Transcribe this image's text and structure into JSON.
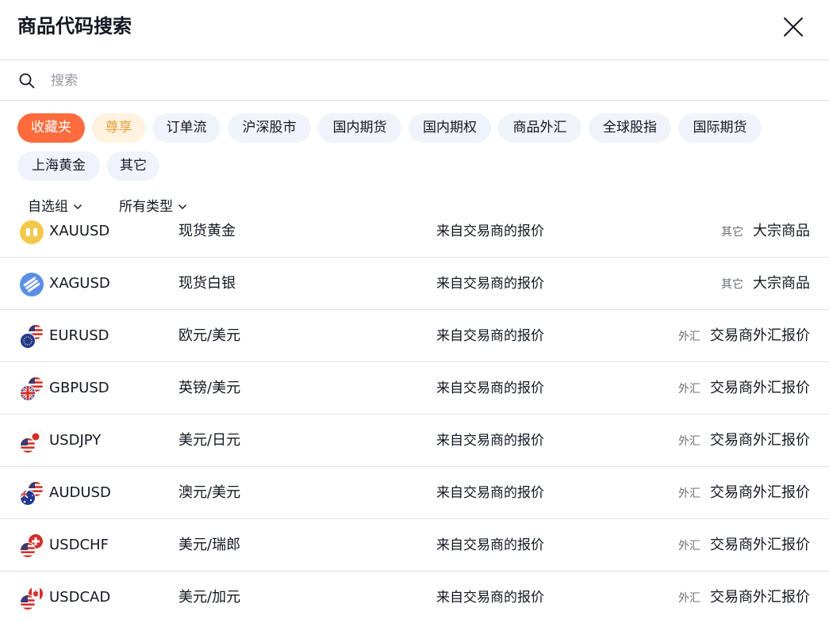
{
  "dialog": {
    "title": "商品代码搜索"
  },
  "search": {
    "placeholder": "搜索"
  },
  "chips": [
    {
      "label": "收藏夹",
      "state": "active"
    },
    {
      "label": "尊享",
      "state": "premium"
    },
    {
      "label": "订单流",
      "state": "normal"
    },
    {
      "label": "沪深股市",
      "state": "normal"
    },
    {
      "label": "国内期货",
      "state": "normal"
    },
    {
      "label": "国内期权",
      "state": "normal"
    },
    {
      "label": "商品外汇",
      "state": "normal"
    },
    {
      "label": "全球股指",
      "state": "normal"
    },
    {
      "label": "国际期货",
      "state": "normal"
    },
    {
      "label": "上海黄金",
      "state": "normal"
    },
    {
      "label": "其它",
      "state": "normal"
    }
  ],
  "filters": {
    "watchlist_label": "自选组",
    "type_label": "所有类型"
  },
  "rows": [
    {
      "symbol": "XAUUSD",
      "description": "现货黄金",
      "source": "来自交易商的报价",
      "type": "其它",
      "exchange": "大宗商品",
      "logo": "gold-bar-icon"
    },
    {
      "symbol": "XAGUSD",
      "description": "现货白银",
      "source": "来自交易商的报价",
      "type": "其它",
      "exchange": "大宗商品",
      "logo": "silver-bar-icon"
    },
    {
      "symbol": "EURUSD",
      "description": "欧元/美元",
      "source": "来自交易商的报价",
      "type": "外汇",
      "exchange": "交易商外汇报价",
      "logo": "eu-us-flags-icon"
    },
    {
      "symbol": "GBPUSD",
      "description": "英镑/美元",
      "source": "来自交易商的报价",
      "type": "外汇",
      "exchange": "交易商外汇报价",
      "logo": "gb-us-flags-icon"
    },
    {
      "symbol": "USDJPY",
      "description": "美元/日元",
      "source": "来自交易商的报价",
      "type": "外汇",
      "exchange": "交易商外汇报价",
      "logo": "us-jp-flags-icon"
    },
    {
      "symbol": "AUDUSD",
      "description": "澳元/美元",
      "source": "来自交易商的报价",
      "type": "外汇",
      "exchange": "交易商外汇报价",
      "logo": "au-us-flags-icon"
    },
    {
      "symbol": "USDCHF",
      "description": "美元/瑞郎",
      "source": "来自交易商的报价",
      "type": "外汇",
      "exchange": "交易商外汇报价",
      "logo": "us-ch-flags-icon"
    },
    {
      "symbol": "USDCAD",
      "description": "美元/加元",
      "source": "来自交易商的报价",
      "type": "外汇",
      "exchange": "交易商外汇报价",
      "logo": "us-ca-flags-icon"
    }
  ],
  "colors": {
    "accent": "#ff6b3d",
    "premium": "#e8a23d",
    "chip_bg": "#f0f3fa",
    "divider": "#e0e3eb"
  }
}
